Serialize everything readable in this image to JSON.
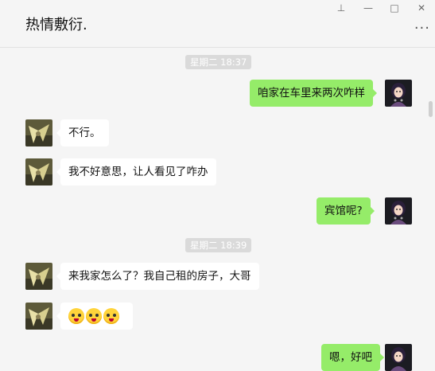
{
  "header": {
    "title": "热情敷衍."
  },
  "window_controls": {
    "pin_label": "⊥",
    "minimize_label": "—",
    "maximize_label": "□",
    "close_label": "✕",
    "more_label": "···"
  },
  "messages": {
    "time1": "星期二 18:37",
    "m1": "咱家在车里来两次咋样",
    "m2": "不行。",
    "m3": "我不好意思，让人看见了咋办",
    "m4": "宾馆呢?",
    "time2": "星期二 18:39",
    "m5": "来我家怎么了？我自己租的房子，大哥",
    "m6_emojis": [
      "drooling-face",
      "drooling-face",
      "drooling-face"
    ],
    "m7": "嗯，好吧"
  },
  "colors": {
    "sent_bubble": "#95ec69",
    "received_bubble": "#ffffff",
    "background": "#f5f5f5"
  }
}
